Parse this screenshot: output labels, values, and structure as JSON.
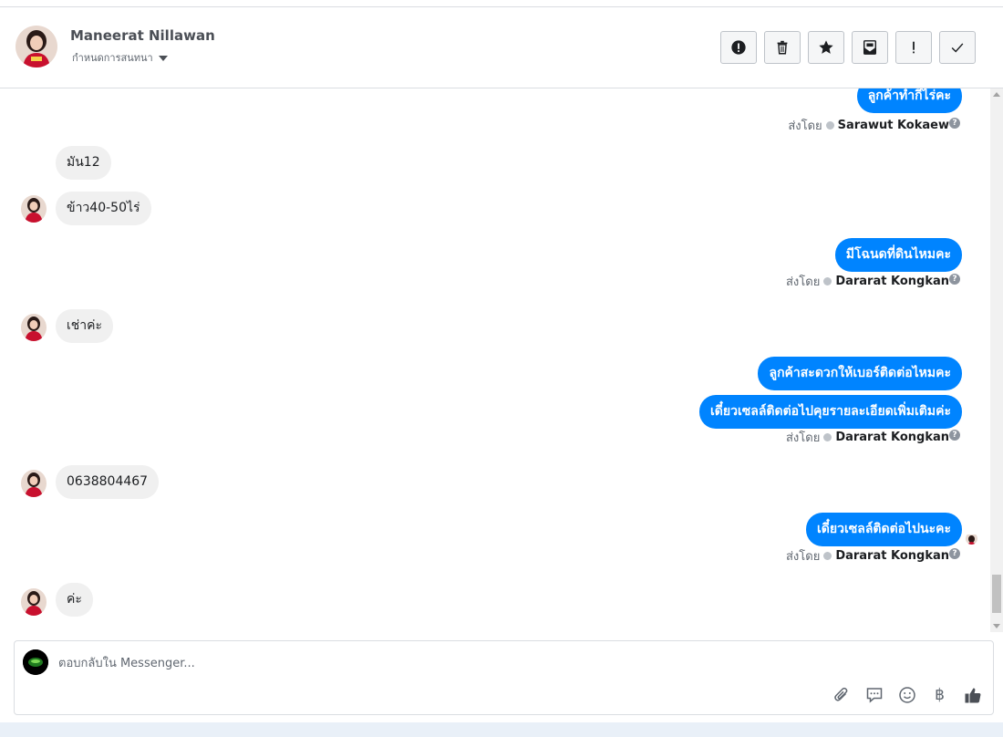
{
  "header": {
    "name": "Maneerat Nillawan",
    "subtitle": "กำหนดการสนทนา",
    "actions": [
      {
        "id": "spam",
        "icon": "alert-circle-icon"
      },
      {
        "id": "delete",
        "icon": "trash-icon"
      },
      {
        "id": "star",
        "icon": "star-icon"
      },
      {
        "id": "unread",
        "icon": "mark-unread-icon"
      },
      {
        "id": "important",
        "icon": "exclamation-icon"
      },
      {
        "id": "done",
        "icon": "checkmark-icon"
      }
    ]
  },
  "messages": {
    "m0": "ลูกค้าทำกี่ไร่คะ",
    "sent0_label": "ส่งโดย",
    "sent0_name": "Sarawut Kokaew",
    "m1": "มัน12",
    "m2": "ข้าว40-50ไร่",
    "m3": "มีโฉนดที่ดินไหมคะ",
    "sent1_label": "ส่งโดย",
    "sent1_name": "Dararat Kongkan",
    "m4": "เช่าค่ะ",
    "m5": "ลูกค้าสะดวกให้เบอร์ติดต่อไหมคะ",
    "m6": "เดี๋ยวเซลล์ติดต่อไปคุยรายละเอียดเพิ่มเติมค่ะ",
    "sent2_label": "ส่งโดย",
    "sent2_name": "Dararat Kongkan",
    "m7": "0638804467",
    "m8": "เดี๋ยวเซลล์ติดต่อไปนะคะ",
    "sent3_label": "ส่งโดย",
    "sent3_name": "Dararat Kongkan",
    "m9": "ค่ะ",
    "help": "?"
  },
  "composer": {
    "placeholder": "ตอบกลับใน Messenger...",
    "tools": [
      "paperclip-icon",
      "saved-replies-icon",
      "emoji-icon",
      "baht-icon",
      "thumbs-up-icon"
    ],
    "baht": "฿"
  },
  "colors": {
    "outgoing": "#0084ff",
    "incoming": "#f0f0f0",
    "like": "#4b4f56"
  }
}
